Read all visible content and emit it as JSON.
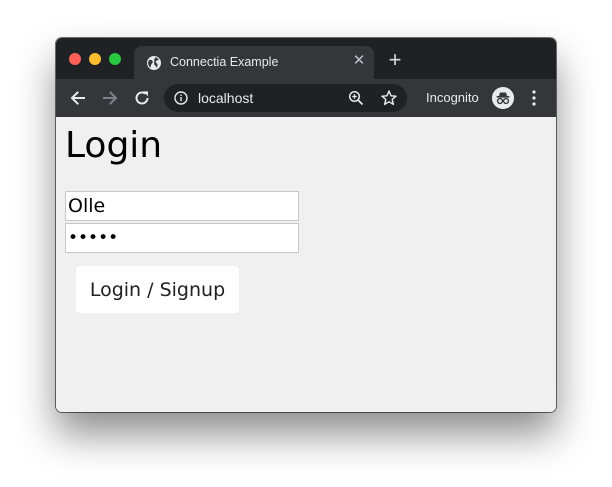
{
  "browser": {
    "tab": {
      "title": "Connectia Example",
      "favicon": "globe-icon",
      "close_icon": "close-icon"
    },
    "new_tab_icon": "plus-icon",
    "address": "localhost",
    "incognito_label": "Incognito",
    "nav_icons": [
      "arrow-left-icon",
      "arrow-right-icon",
      "reload-icon"
    ],
    "colors": {
      "tabstrip": "#202124",
      "toolbar": "#35363a",
      "omnibox": "#202124",
      "page_bg": "#f0f0f0"
    }
  },
  "page": {
    "heading": "Login",
    "username_value": "Olle",
    "password_value": "•••••",
    "submit_label": "Login / Signup"
  }
}
